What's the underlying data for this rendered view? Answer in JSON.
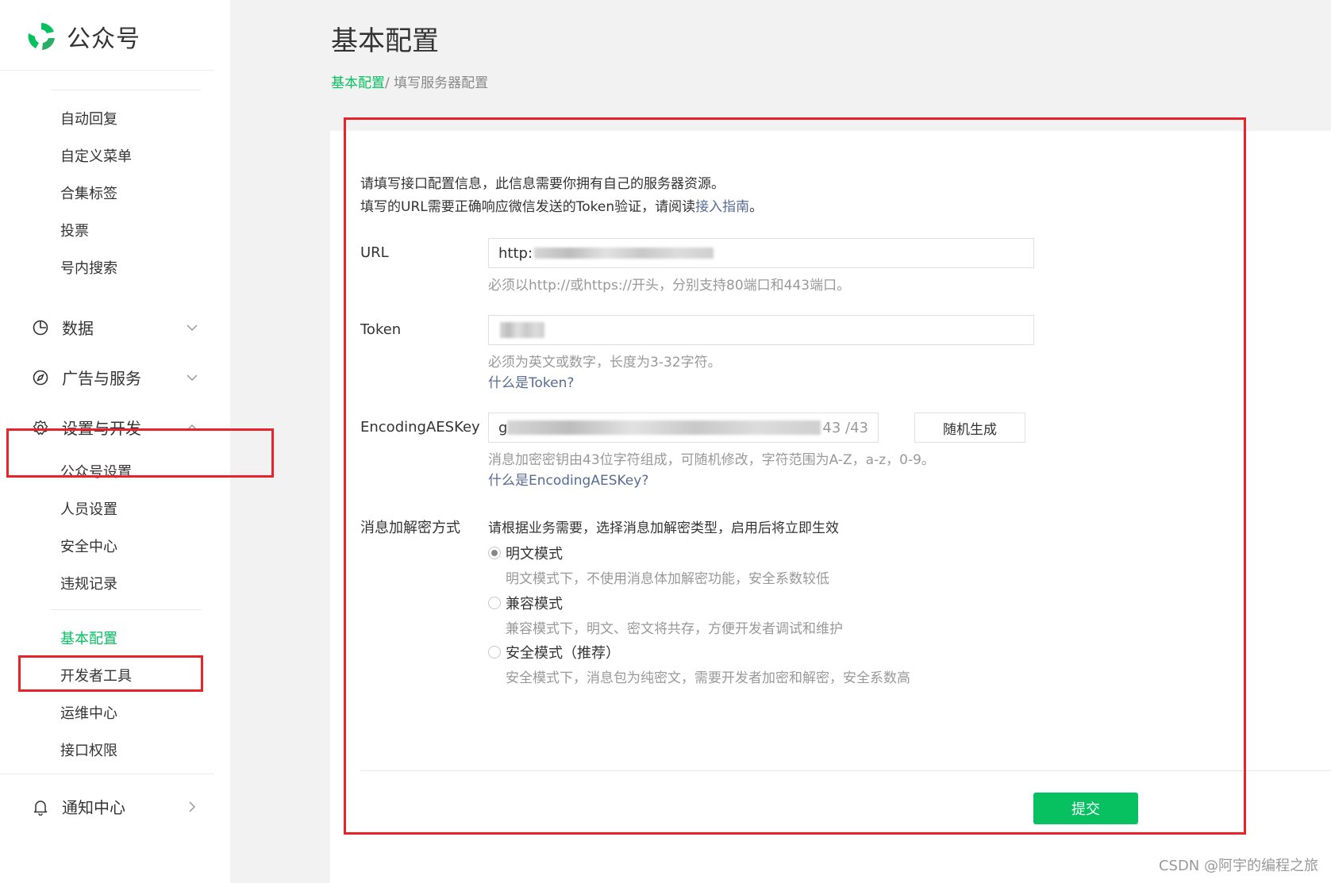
{
  "brand": {
    "name": "公众号",
    "logo_colors": [
      "#07c160",
      "#2aae67"
    ]
  },
  "sidebar": {
    "top_items": [
      {
        "label": "自动回复"
      },
      {
        "label": "自定义菜单"
      },
      {
        "label": "合集标签"
      },
      {
        "label": "投票"
      },
      {
        "label": "号内搜索"
      }
    ],
    "groups": {
      "data": {
        "label": "数据",
        "icon": "chart-pie-icon",
        "expanded": false
      },
      "ads": {
        "label": "广告与服务",
        "icon": "compass-icon",
        "expanded": false
      },
      "settings": {
        "label": "设置与开发",
        "icon": "gear-icon",
        "expanded": true
      },
      "notify": {
        "label": "通知中心",
        "icon": "bell-icon",
        "expanded": false
      }
    },
    "settings_items": [
      {
        "label": "公众号设置"
      },
      {
        "label": "人员设置"
      },
      {
        "label": "安全中心"
      },
      {
        "label": "违规记录"
      }
    ],
    "dev_items": [
      {
        "label": "基本配置",
        "active": true
      },
      {
        "label": "开发者工具"
      },
      {
        "label": "运维中心"
      },
      {
        "label": "接口权限"
      }
    ]
  },
  "page": {
    "title": "基本配置",
    "breadcrumb": {
      "root": "基本配置",
      "sep": "/ ",
      "current": "填写服务器配置"
    }
  },
  "form": {
    "intro_line1": "请填写接口配置信息，此信息需要你拥有自己的服务器资源。",
    "intro_line2_prefix": "填写的URL需要正确响应微信发送的Token验证，请阅读",
    "intro_link": "接入指南",
    "intro_line2_suffix": "。",
    "url": {
      "label": "URL",
      "value": "http:",
      "hint": "必须以http://或https://开头，分别支持80端口和443端口。"
    },
    "token": {
      "label": "Token",
      "hint": "必须为英文或数字，长度为3-32字符。",
      "help_link": "什么是Token?"
    },
    "aeskey": {
      "label": "EncodingAESKey",
      "value": "g",
      "counter": "43 /43",
      "generate_button": "随机生成",
      "hint": "消息加密密钥由43位字符组成，可随机修改，字符范围为A-Z，a-z，0-9。",
      "help_link": "什么是EncodingAESKey?"
    },
    "encrypt_mode": {
      "label": "消息加解密方式",
      "description": "请根据业务需要，选择消息加解密类型，启用后将立即生效",
      "options": [
        {
          "label": "明文模式",
          "desc": "明文模式下，不使用消息体加解密功能，安全系数较低",
          "selected": true
        },
        {
          "label": "兼容模式",
          "desc": "兼容模式下，明文、密文将共存，方便开发者调试和维护",
          "selected": false
        },
        {
          "label": "安全模式（推荐）",
          "desc": "安全模式下，消息包为纯密文，需要开发者加密和解密，安全系数高",
          "selected": false
        }
      ]
    },
    "submit_label": "提交"
  },
  "colors": {
    "accent": "#07c160",
    "link": "#576b95",
    "highlight": "#e8242a"
  },
  "watermark": "CSDN @阿宇的编程之旅"
}
